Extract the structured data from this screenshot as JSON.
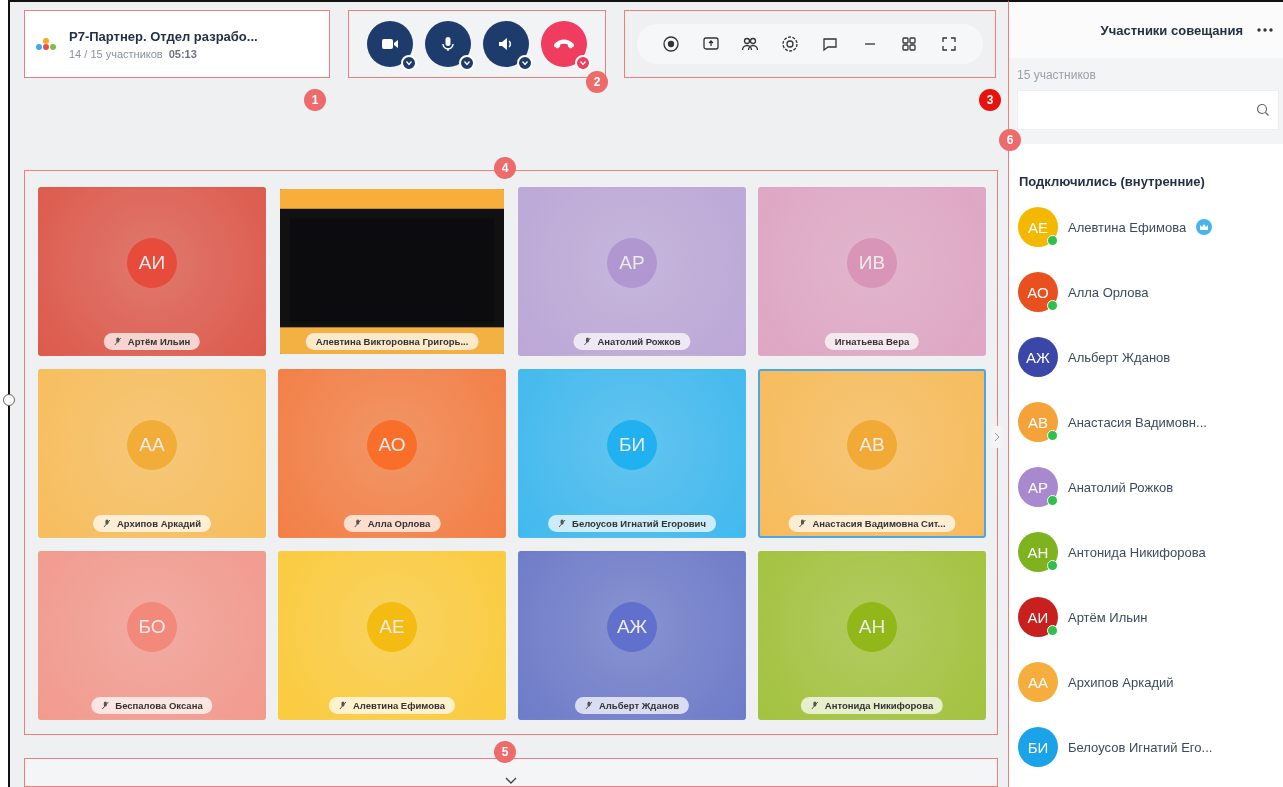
{
  "meeting": {
    "title": "Р7-Партнер. Отдел разрабо...",
    "participants": "14 / 15 участников",
    "timer": "05:13"
  },
  "call_controls": [
    {
      "kind": "camera"
    },
    {
      "kind": "mic"
    },
    {
      "kind": "speaker"
    },
    {
      "kind": "hangup"
    }
  ],
  "toolbar": [
    {
      "kind": "record"
    },
    {
      "kind": "screen"
    },
    {
      "kind": "people"
    },
    {
      "kind": "settings"
    },
    {
      "kind": "chat"
    },
    {
      "kind": "minimize"
    },
    {
      "kind": "grid"
    },
    {
      "kind": "fullscreen"
    }
  ],
  "tiles": [
    {
      "initials": "АИ",
      "name": "Артём Ильин",
      "color": "#dc5a4c",
      "muted": true,
      "selected": false,
      "kind": "avatar"
    },
    {
      "name": "Алевтина Викторовна Григорь...",
      "muted": false,
      "selected": false,
      "kind": "picture"
    },
    {
      "initials": "АР",
      "name": "Анатолий Рожков",
      "color": "#bca7d6",
      "muted": true,
      "selected": false,
      "kind": "avatar"
    },
    {
      "initials": "ИВ",
      "name": "Игнатьева Вера",
      "color": "#dea6c3",
      "muted": false,
      "selected": false,
      "kind": "avatar"
    },
    {
      "initials": "АА",
      "name": "Архипов Аркадий",
      "color": "#f7bd5c",
      "muted": true,
      "selected": false,
      "kind": "avatar"
    },
    {
      "initials": "АО",
      "name": "Алла Орлова",
      "color": "#f27f45",
      "muted": true,
      "selected": false,
      "kind": "avatar"
    },
    {
      "initials": "БИ",
      "name": "Белоусов Игнатий Егорович",
      "color": "#41b9ee",
      "muted": true,
      "selected": false,
      "kind": "avatar"
    },
    {
      "initials": "АВ",
      "name": "Анастасия Вадимовна Сит...",
      "color": "#f7bb5a",
      "muted": true,
      "selected": true,
      "kind": "avatar"
    },
    {
      "initials": "БО",
      "name": "Беспалова Оксана",
      "color": "#f29a8e",
      "muted": true,
      "selected": false,
      "kind": "avatar"
    },
    {
      "initials": "АЕ",
      "name": "Алевтина Ефимова",
      "color": "#fbcb3e",
      "muted": true,
      "selected": false,
      "kind": "avatar"
    },
    {
      "initials": "АЖ",
      "name": "Альберт Жданов",
      "color": "#6e7bc8",
      "muted": true,
      "selected": false,
      "kind": "avatar"
    },
    {
      "initials": "АН",
      "name": "Антонида Никифорова",
      "color": "#a3c23e",
      "muted": true,
      "selected": false,
      "kind": "avatar"
    }
  ],
  "sidebar": {
    "title": "Участники совещания",
    "count": "15 участников",
    "group": "Подключились (внутренние)",
    "participants": [
      {
        "initials": "АЕ",
        "name": "Алевтина Ефимова",
        "color": "#f5b800",
        "online": true,
        "moderator": true
      },
      {
        "initials": "АО",
        "name": "Алла Орлова",
        "color": "#e8501f",
        "online": true,
        "moderator": false
      },
      {
        "initials": "АЖ",
        "name": "Альберт Жданов",
        "color": "#3b47a8",
        "online": false,
        "moderator": false
      },
      {
        "initials": "АВ",
        "name": "Анастасия Вадимовн...",
        "color": "#f5a23a",
        "online": true,
        "moderator": false
      },
      {
        "initials": "АР",
        "name": "Анатолий Рожков",
        "color": "#a888cf",
        "online": true,
        "moderator": false
      },
      {
        "initials": "АН",
        "name": "Антонида Никифорова",
        "color": "#7fb21f",
        "online": true,
        "moderator": false
      },
      {
        "initials": "АИ",
        "name": "Артём Ильин",
        "color": "#c8201e",
        "online": true,
        "moderator": false
      },
      {
        "initials": "АА",
        "name": "Архипов Аркадий",
        "color": "#f5ad3d",
        "online": false,
        "moderator": false
      },
      {
        "initials": "БИ",
        "name": "Белоусов Игнатий Его...",
        "color": "#1aa3e8",
        "online": false,
        "moderator": false
      }
    ]
  },
  "callouts": [
    {
      "number": "1",
      "color": "#ee6b6b"
    },
    {
      "number": "2",
      "color": "#ee6b6b"
    },
    {
      "number": "3",
      "color": "#e8120f"
    },
    {
      "number": "6",
      "color": "#ee6b6b"
    },
    {
      "number": "4",
      "color": "#ee6b6b"
    },
    {
      "number": "5",
      "color": "#ee6b6b"
    }
  ]
}
